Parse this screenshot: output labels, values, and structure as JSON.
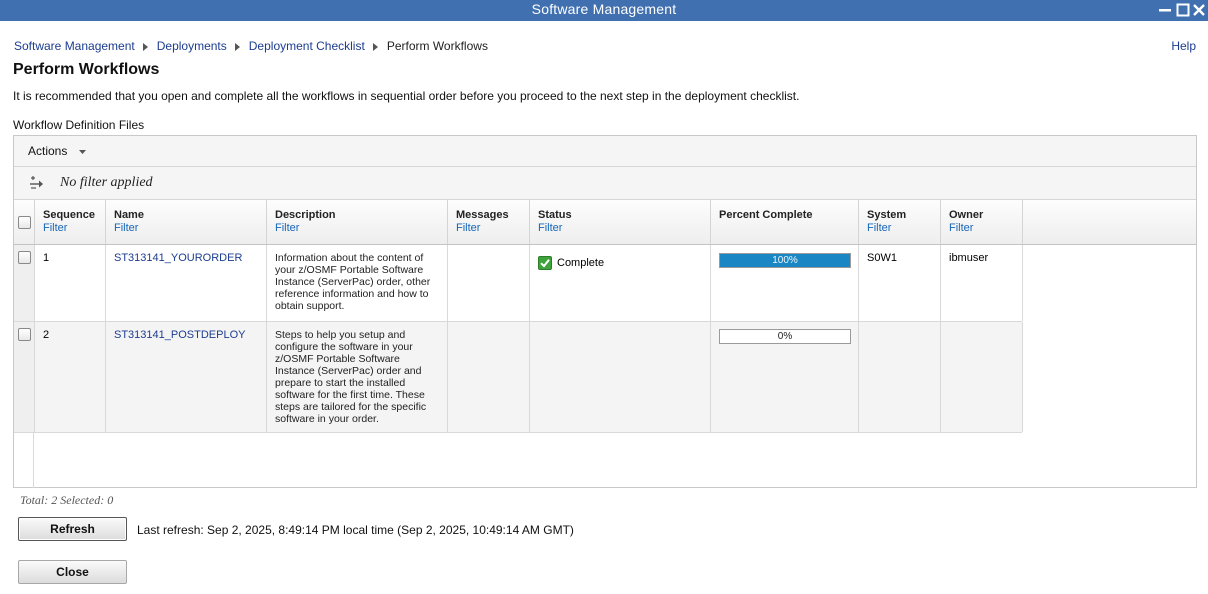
{
  "window": {
    "title": "Software Management"
  },
  "breadcrumb": {
    "items": [
      "Software Management",
      "Deployments",
      "Deployment Checklist"
    ],
    "current": "Perform Workflows"
  },
  "help_label": "Help",
  "page": {
    "title": "Perform Workflows",
    "intro": "It is recommended that you open and complete all the workflows in sequential order before you proceed to the next step in the deployment checklist.",
    "section_label": "Workflow Definition Files"
  },
  "toolbar": {
    "actions_label": "Actions",
    "filter_status": "No filter applied"
  },
  "table": {
    "filter_label": "Filter",
    "columns": [
      "Sequence",
      "Name",
      "Description",
      "Messages",
      "Status",
      "Percent Complete",
      "System",
      "Owner"
    ],
    "rows": [
      {
        "sequence": "1",
        "name": "ST313141_YOURORDER",
        "description": "Information about the content of your z/OSMF Portable Software Instance (ServerPac) order, other reference information and how to obtain support.",
        "messages": "",
        "status": "Complete",
        "percent_complete": 100,
        "percent_label": "100%",
        "system": "S0W1",
        "owner": "ibmuser"
      },
      {
        "sequence": "2",
        "name": "ST313141_POSTDEPLOY",
        "description": "Steps to help you setup and configure the software in your z/OSMF Portable Software Instance (ServerPac) order and prepare to start the installed software for the first time. These steps are tailored for the specific software in your order.",
        "messages": "",
        "status": "",
        "percent_complete": 0,
        "percent_label": "0%",
        "system": "",
        "owner": ""
      }
    ]
  },
  "totals": "Total: 2 Selected: 0",
  "buttons": {
    "refresh": "Refresh",
    "close": "Close"
  },
  "last_refresh": "Last refresh: Sep 2, 2025, 8:49:14 PM local time (Sep 2, 2025, 10:49:14 AM GMT)",
  "colors": {
    "titlebar": "#4170b1",
    "link": "#1c3c8f",
    "filter_link": "#1565b8",
    "progress_fill": "#1a87c4",
    "status_ok": "#3ea33a"
  },
  "icons": [
    "minimize-icon",
    "maximize-icon",
    "close-icon",
    "breadcrumb-chevron-icon",
    "caret-down-icon",
    "filter-icon",
    "checkmark-icon"
  ]
}
